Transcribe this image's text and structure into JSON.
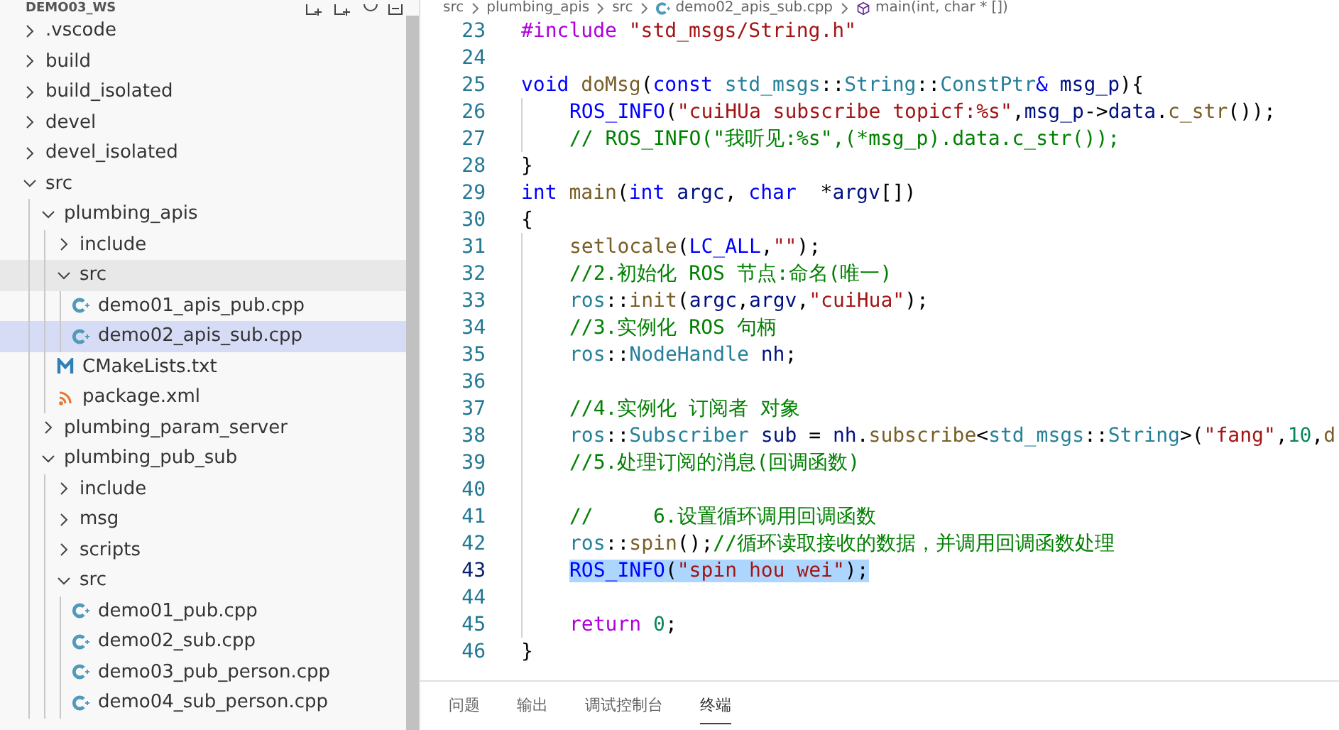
{
  "explorer": {
    "title": "DEMO03_WS",
    "tree": [
      {
        "label": ".vscode",
        "kind": "folder",
        "expanded": false,
        "selected": false,
        "hovered": false
      },
      {
        "label": "build",
        "kind": "folder",
        "expanded": false,
        "selected": false,
        "hovered": false
      },
      {
        "label": "build_isolated",
        "kind": "folder",
        "expanded": false,
        "selected": false,
        "hovered": false
      },
      {
        "label": "devel",
        "kind": "folder",
        "expanded": false,
        "selected": false,
        "hovered": false
      },
      {
        "label": "devel_isolated",
        "kind": "folder",
        "expanded": false,
        "selected": false,
        "hovered": false
      },
      {
        "label": "src",
        "kind": "folder",
        "expanded": true,
        "selected": false,
        "hovered": false,
        "children": [
          {
            "label": "plumbing_apis",
            "kind": "folder",
            "expanded": true,
            "selected": false,
            "hovered": false,
            "children": [
              {
                "label": "include",
                "kind": "folder",
                "expanded": false,
                "selected": false,
                "hovered": false
              },
              {
                "label": "src",
                "kind": "folder",
                "expanded": true,
                "selected": false,
                "hovered": true,
                "children": [
                  {
                    "label": "demo01_apis_pub.cpp",
                    "kind": "cpp",
                    "selected": false,
                    "hovered": false
                  },
                  {
                    "label": "demo02_apis_sub.cpp",
                    "kind": "cpp",
                    "selected": true,
                    "hovered": false
                  }
                ]
              },
              {
                "label": "CMakeLists.txt",
                "kind": "cmake",
                "selected": false,
                "hovered": false
              },
              {
                "label": "package.xml",
                "kind": "xml",
                "selected": false,
                "hovered": false
              }
            ]
          },
          {
            "label": "plumbing_param_server",
            "kind": "folder",
            "expanded": false,
            "selected": false,
            "hovered": false
          },
          {
            "label": "plumbing_pub_sub",
            "kind": "folder",
            "expanded": true,
            "selected": false,
            "hovered": false,
            "children": [
              {
                "label": "include",
                "kind": "folder",
                "expanded": false,
                "selected": false,
                "hovered": false
              },
              {
                "label": "msg",
                "kind": "folder",
                "expanded": false,
                "selected": false,
                "hovered": false
              },
              {
                "label": "scripts",
                "kind": "folder",
                "expanded": false,
                "selected": false,
                "hovered": false
              },
              {
                "label": "src",
                "kind": "folder",
                "expanded": true,
                "selected": false,
                "hovered": false,
                "children": [
                  {
                    "label": "demo01_pub.cpp",
                    "kind": "cpp",
                    "selected": false,
                    "hovered": false
                  },
                  {
                    "label": "demo02_sub.cpp",
                    "kind": "cpp",
                    "selected": false,
                    "hovered": false
                  },
                  {
                    "label": "demo03_pub_person.cpp",
                    "kind": "cpp",
                    "selected": false,
                    "hovered": false
                  },
                  {
                    "label": "demo04_sub_person.cpp",
                    "kind": "cpp",
                    "selected": false,
                    "hovered": false
                  }
                ]
              }
            ]
          }
        ]
      }
    ]
  },
  "breadcrumb": [
    {
      "label": "src",
      "kind": "folder"
    },
    {
      "label": "plumbing_apis",
      "kind": "folder"
    },
    {
      "label": "src",
      "kind": "folder"
    },
    {
      "label": "demo02_apis_sub.cpp",
      "kind": "cpp"
    },
    {
      "label": "main(int, char * [])",
      "kind": "method"
    }
  ],
  "editor": {
    "lines": [
      {
        "number": "23",
        "selected": false,
        "indented": false,
        "tokens": [
          {
            "text": "#include ",
            "kind": "control"
          },
          {
            "text": "\"std_msgs/String.h\"",
            "kind": "string"
          }
        ]
      },
      {
        "number": "24",
        "selected": false,
        "indented": false
      },
      {
        "number": "25",
        "selected": false,
        "indented": false,
        "tokens": [
          {
            "text": "void ",
            "kind": "keyword"
          },
          {
            "text": "doMsg",
            "kind": "function"
          },
          {
            "text": "(",
            "kind": "plain"
          },
          {
            "text": "const ",
            "kind": "keyword"
          },
          {
            "text": "std_msgs",
            "kind": "type"
          },
          {
            "text": "::",
            "kind": "plain"
          },
          {
            "text": "String",
            "kind": "type"
          },
          {
            "text": "::",
            "kind": "plain"
          },
          {
            "text": "ConstPtr",
            "kind": "type"
          },
          {
            "text": "& ",
            "kind": "keyword"
          },
          {
            "text": "msg_p",
            "kind": "variable"
          },
          {
            "text": "){",
            "kind": "plain"
          }
        ]
      },
      {
        "number": "26",
        "selected": false,
        "indented": true,
        "tokens": [
          {
            "text": "ROS_INFO",
            "kind": "keyword"
          },
          {
            "text": "(",
            "kind": "plain"
          },
          {
            "text": "\"cuiHUa subscribe topicf:%s\"",
            "kind": "string"
          },
          {
            "text": ",",
            "kind": "plain"
          },
          {
            "text": "msg_p",
            "kind": "variable"
          },
          {
            "text": "->",
            "kind": "plain"
          },
          {
            "text": "data",
            "kind": "variable"
          },
          {
            "text": ".",
            "kind": "plain"
          },
          {
            "text": "c_str",
            "kind": "function"
          },
          {
            "text": "());",
            "kind": "plain"
          }
        ]
      },
      {
        "number": "27",
        "selected": false,
        "indented": true,
        "tokens": [
          {
            "text": "// ROS_INFO(\"我听见:%s\",(*msg_p).data.c_str());",
            "kind": "comment"
          }
        ]
      },
      {
        "number": "28",
        "selected": false,
        "indented": false,
        "tokens": [
          {
            "text": "}",
            "kind": "plain"
          }
        ]
      },
      {
        "number": "29",
        "selected": false,
        "indented": false,
        "tokens": [
          {
            "text": "int ",
            "kind": "keyword"
          },
          {
            "text": "main",
            "kind": "function"
          },
          {
            "text": "(",
            "kind": "plain"
          },
          {
            "text": "int ",
            "kind": "keyword"
          },
          {
            "text": "argc",
            "kind": "variable"
          },
          {
            "text": ", ",
            "kind": "plain"
          },
          {
            "text": "char",
            "kind": "keyword"
          },
          {
            "text": "  *",
            "kind": "plain"
          },
          {
            "text": "argv",
            "kind": "variable"
          },
          {
            "text": "[])",
            "kind": "plain"
          }
        ]
      },
      {
        "number": "30",
        "selected": false,
        "indented": false,
        "tokens": [
          {
            "text": "{",
            "kind": "plain"
          }
        ]
      },
      {
        "number": "31",
        "selected": false,
        "indented": true,
        "tokens": [
          {
            "text": "setlocale",
            "kind": "function"
          },
          {
            "text": "(",
            "kind": "plain"
          },
          {
            "text": "LC_ALL",
            "kind": "keyword"
          },
          {
            "text": ",",
            "kind": "plain"
          },
          {
            "text": "\"\"",
            "kind": "string"
          },
          {
            "text": ");",
            "kind": "plain"
          }
        ]
      },
      {
        "number": "32",
        "selected": false,
        "indented": true,
        "tokens": [
          {
            "text": "//2.初始化 ROS 节点:命名(唯一)",
            "kind": "comment"
          }
        ]
      },
      {
        "number": "33",
        "selected": false,
        "indented": true,
        "tokens": [
          {
            "text": "ros",
            "kind": "type"
          },
          {
            "text": "::",
            "kind": "plain"
          },
          {
            "text": "init",
            "kind": "function"
          },
          {
            "text": "(",
            "kind": "plain"
          },
          {
            "text": "argc",
            "kind": "variable"
          },
          {
            "text": ",",
            "kind": "plain"
          },
          {
            "text": "argv",
            "kind": "variable"
          },
          {
            "text": ",",
            "kind": "plain"
          },
          {
            "text": "\"cuiHua\"",
            "kind": "string"
          },
          {
            "text": ");",
            "kind": "plain"
          }
        ]
      },
      {
        "number": "34",
        "selected": false,
        "indented": true,
        "tokens": [
          {
            "text": "//3.实例化 ROS 句柄",
            "kind": "comment"
          }
        ]
      },
      {
        "number": "35",
        "selected": false,
        "indented": true,
        "tokens": [
          {
            "text": "ros",
            "kind": "type"
          },
          {
            "text": "::",
            "kind": "plain"
          },
          {
            "text": "NodeHandle ",
            "kind": "type"
          },
          {
            "text": "nh",
            "kind": "variable"
          },
          {
            "text": ";",
            "kind": "plain"
          }
        ]
      },
      {
        "number": "36",
        "selected": false,
        "indented": true
      },
      {
        "number": "37",
        "selected": false,
        "indented": true,
        "tokens": [
          {
            "text": "//4.实例化 订阅者 对象",
            "kind": "comment"
          }
        ]
      },
      {
        "number": "38",
        "selected": false,
        "indented": true,
        "tokens": [
          {
            "text": "ros",
            "kind": "type"
          },
          {
            "text": "::",
            "kind": "plain"
          },
          {
            "text": "Subscriber ",
            "kind": "type"
          },
          {
            "text": "sub",
            "kind": "variable"
          },
          {
            "text": " = ",
            "kind": "plain"
          },
          {
            "text": "nh",
            "kind": "variable"
          },
          {
            "text": ".",
            "kind": "plain"
          },
          {
            "text": "subscribe",
            "kind": "function"
          },
          {
            "text": "<",
            "kind": "plain"
          },
          {
            "text": "std_msgs",
            "kind": "type"
          },
          {
            "text": "::",
            "kind": "plain"
          },
          {
            "text": "String",
            "kind": "type"
          },
          {
            "text": ">(",
            "kind": "plain"
          },
          {
            "text": "\"fang\"",
            "kind": "string"
          },
          {
            "text": ",",
            "kind": "plain"
          },
          {
            "text": "10",
            "kind": "number"
          },
          {
            "text": ",",
            "kind": "plain"
          },
          {
            "text": "d",
            "kind": "function"
          }
        ]
      },
      {
        "number": "39",
        "selected": false,
        "indented": true,
        "tokens": [
          {
            "text": "//5.处理订阅的消息(回调函数)",
            "kind": "comment"
          }
        ]
      },
      {
        "number": "40",
        "selected": false,
        "indented": true
      },
      {
        "number": "41",
        "selected": false,
        "indented": true,
        "tokens": [
          {
            "text": "//     6.设置循环调用回调函数",
            "kind": "comment"
          }
        ]
      },
      {
        "number": "42",
        "selected": false,
        "indented": true,
        "tokens": [
          {
            "text": "ros",
            "kind": "type"
          },
          {
            "text": "::",
            "kind": "plain"
          },
          {
            "text": "spin",
            "kind": "function"
          },
          {
            "text": "();",
            "kind": "plain"
          },
          {
            "text": "//循环读取接收的数据，并调用回调函数处理",
            "kind": "comment"
          }
        ]
      },
      {
        "number": "43",
        "selected": true,
        "indented": true,
        "tokens": [
          {
            "text": "ROS_INFO",
            "kind": "keyword"
          },
          {
            "text": "(",
            "kind": "plain"
          },
          {
            "text": "\"spin hou wei\"",
            "kind": "string"
          },
          {
            "text": ");",
            "kind": "plain"
          }
        ]
      },
      {
        "number": "44",
        "selected": false,
        "indented": true
      },
      {
        "number": "45",
        "selected": false,
        "indented": true,
        "tokens": [
          {
            "text": "return ",
            "kind": "control"
          },
          {
            "text": "0",
            "kind": "number"
          },
          {
            "text": ";",
            "kind": "plain"
          }
        ]
      },
      {
        "number": "46",
        "selected": false,
        "indented": false,
        "tokens": [
          {
            "text": "}",
            "kind": "plain"
          }
        ]
      }
    ]
  },
  "panel": {
    "tabs": [
      {
        "label": "问题",
        "selected": false
      },
      {
        "label": "输出",
        "selected": false
      },
      {
        "label": "调试控制台",
        "selected": false
      },
      {
        "label": "终端",
        "selected": true
      }
    ]
  }
}
